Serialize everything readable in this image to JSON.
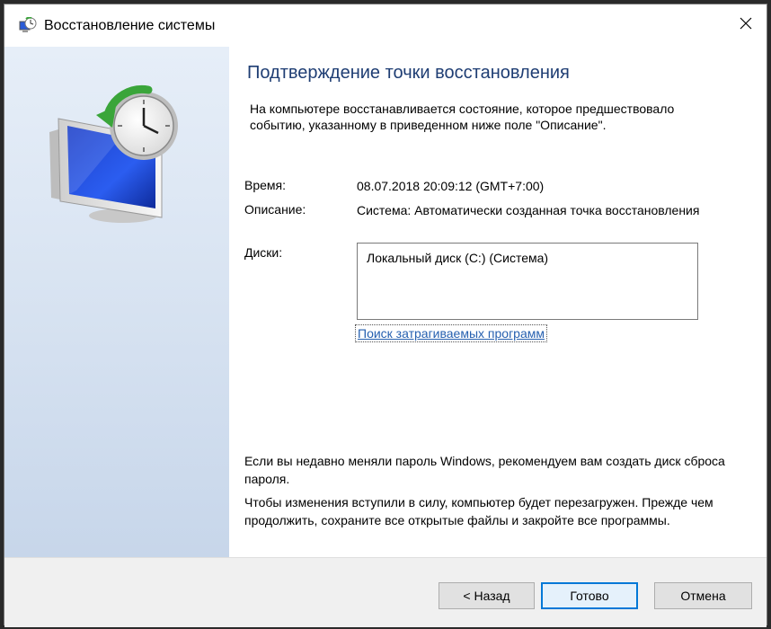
{
  "window": {
    "title": "Восстановление системы"
  },
  "main": {
    "heading": "Подтверждение точки восстановления",
    "intro": "На компьютере восстанавливается состояние, которое предшествовало событию, указанному в приведенном ниже поле \"Описание\".",
    "time_label": "Время:",
    "time_value": "08.07.2018 20:09:12 (GMT+7:00)",
    "desc_label": "Описание:",
    "desc_value": "Система: Автоматически созданная точка восстановления",
    "disks_label": "Диски:",
    "disks_value": "Локальный диск (C:) (Система)",
    "affected_link": "Поиск затрагиваемых программ",
    "note_password": "Если вы недавно меняли пароль Windows, рекомендуем вам создать диск сброса пароля.",
    "note_restart": "Чтобы изменения вступили в силу, компьютер будет перезагружен. Прежде чем продолжить, сохраните все открытые файлы и закройте все программы."
  },
  "footer": {
    "back_label": "< Назад",
    "finish_label": "Готово",
    "cancel_label": "Отмена"
  },
  "icons": {
    "title": "system-restore-icon",
    "close": "close-icon",
    "hero": "system-restore-monitor-clock-icon"
  },
  "colors": {
    "heading": "#1e3d73",
    "link": "#2660b0",
    "default_button_border": "#0078d7",
    "sidebar": "#d9e4f2"
  }
}
